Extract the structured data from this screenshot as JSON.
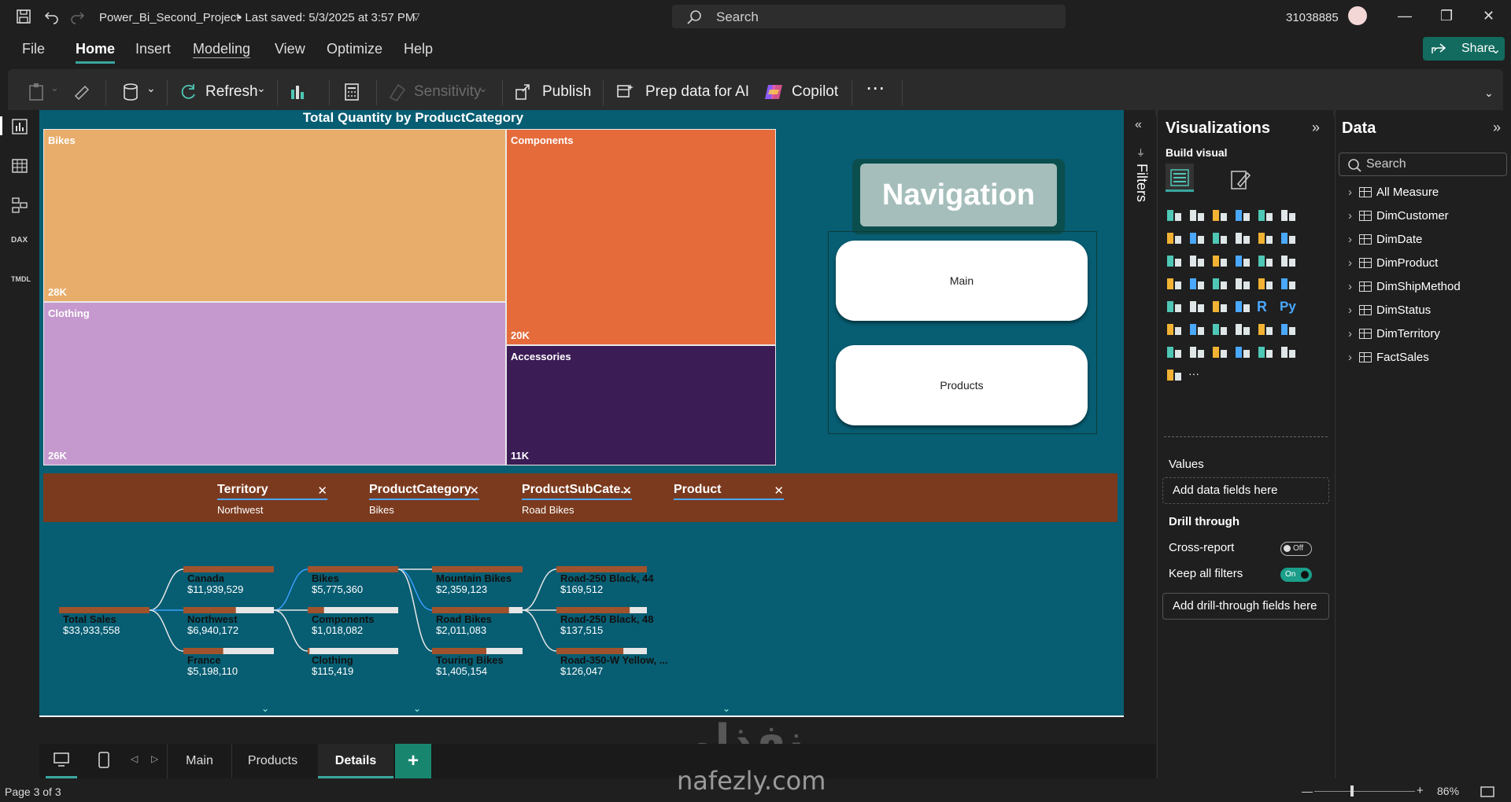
{
  "titlebar": {
    "file_title": "Power_Bi_Second_Project",
    "saved": "• Last saved: 5/3/2025 at 3:57 PM",
    "search_placeholder": "Search",
    "user_id": "31038885"
  },
  "menu": [
    "File",
    "Home",
    "Insert",
    "Modeling",
    "View",
    "Optimize",
    "Help"
  ],
  "share_label": "Share",
  "ribbon": {
    "refresh": "Refresh",
    "sensitivity": "Sensitivity",
    "publish": "Publish",
    "prep": "Prep data for AI",
    "copilot": "Copilot",
    "more": "⋯"
  },
  "treemap": {
    "title": "Total Quantity by ProductCategory",
    "tiles": [
      {
        "name": "Bikes",
        "value": "28K",
        "color": "#e8ad6a"
      },
      {
        "name": "Components",
        "value": "20K",
        "color": "#e56b3b"
      },
      {
        "name": "Clothing",
        "value": "26K",
        "color": "#c599cd"
      },
      {
        "name": "Accessories",
        "value": "11K",
        "color": "#3b1c55"
      }
    ]
  },
  "navigation": {
    "title": "Navigation",
    "buttons": [
      "Main",
      "Products"
    ]
  },
  "decomposition": {
    "levels": [
      {
        "name": "Territory",
        "selected": "Northwest"
      },
      {
        "name": "ProductCategory",
        "selected": "Bikes"
      },
      {
        "name": "ProductSubCate...",
        "selected": "Road Bikes"
      },
      {
        "name": "Product",
        "selected": ""
      }
    ],
    "root": {
      "name": "Total Sales",
      "value": "$33,933,558"
    },
    "columns": [
      [
        {
          "name": "Canada",
          "value": "$11,939,529",
          "fill": 1.0
        },
        {
          "name": "Northwest",
          "value": "$6,940,172",
          "fill": 0.58
        },
        {
          "name": "France",
          "value": "$5,198,110",
          "fill": 0.44
        }
      ],
      [
        {
          "name": "Bikes",
          "value": "$5,775,360",
          "fill": 1.0
        },
        {
          "name": "Components",
          "value": "$1,018,082",
          "fill": 0.18
        },
        {
          "name": "Clothing",
          "value": "$115,419",
          "fill": 0.02
        }
      ],
      [
        {
          "name": "Mountain Bikes",
          "value": "$2,359,123",
          "fill": 1.0
        },
        {
          "name": "Road Bikes",
          "value": "$2,011,083",
          "fill": 0.85
        },
        {
          "name": "Touring Bikes",
          "value": "$1,405,154",
          "fill": 0.6
        }
      ],
      [
        {
          "name": "Road-250 Black, 44",
          "value": "$169,512",
          "fill": 1.0
        },
        {
          "name": "Road-250 Black, 48",
          "value": "$137,515",
          "fill": 0.81
        },
        {
          "name": "Road-350-W Yellow, ...",
          "value": "$126,047",
          "fill": 0.74
        }
      ]
    ]
  },
  "pages": {
    "tabs": [
      "Main",
      "Products",
      "Details"
    ],
    "active": "Details",
    "status": "Page 3 of 3",
    "zoom": "86%"
  },
  "filters_label": "Filters",
  "visualizations": {
    "title": "Visualizations",
    "build": "Build visual",
    "values_label": "Values",
    "values_placeholder": "Add data fields here",
    "drill_title": "Drill through",
    "cross_report": "Cross-report",
    "cross_report_state": "Off",
    "keep_filters": "Keep all filters",
    "keep_filters_state": "On",
    "drill_placeholder": "Add drill-through fields here"
  },
  "data_pane": {
    "title": "Data",
    "search_placeholder": "Search",
    "tables": [
      "All Measure",
      "DimCustomer",
      "DimDate",
      "DimProduct",
      "DimShipMethod",
      "DimStatus",
      "DimTerritory",
      "FactSales"
    ]
  },
  "watermark": {
    "arabic": "نفذلي",
    "latin": "nafezly.com"
  }
}
